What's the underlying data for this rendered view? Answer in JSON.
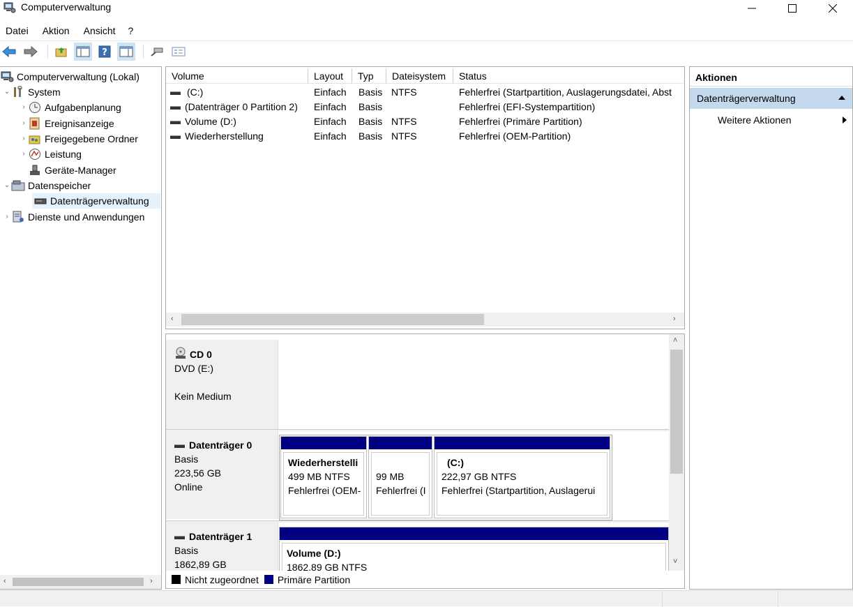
{
  "window": {
    "title": "Computerverwaltung"
  },
  "menu": [
    "Datei",
    "Aktion",
    "Ansicht",
    "?"
  ],
  "tree": {
    "root": "Computerverwaltung (Lokal)",
    "system": "System",
    "system_children": [
      "Aufgabenplanung",
      "Ereignisanzeige",
      "Freigegebene Ordner",
      "Leistung",
      "Geräte-Manager"
    ],
    "storage": "Datenspeicher",
    "storage_children": [
      "Datenträgerverwaltung"
    ],
    "services": "Dienste und Anwendungen"
  },
  "volume_list": {
    "columns": [
      "Volume",
      "Layout",
      "Typ",
      "Dateisystem",
      "Status"
    ],
    "rows": [
      {
        "volume": "(C:)",
        "layout": "Einfach",
        "typ": "Basis",
        "fs": "NTFS",
        "status": "Fehlerfrei (Startpartition, Auslagerungsdatei, Abst"
      },
      {
        "volume": "(Datenträger 0 Partition 2)",
        "layout": "Einfach",
        "typ": "Basis",
        "fs": "",
        "status": "Fehlerfrei (EFI-Systempartition)"
      },
      {
        "volume": "Volume (D:)",
        "layout": "Einfach",
        "typ": "Basis",
        "fs": "NTFS",
        "status": "Fehlerfrei (Primäre Partition)"
      },
      {
        "volume": "Wiederherstellung",
        "layout": "Einfach",
        "typ": "Basis",
        "fs": "NTFS",
        "status": "Fehlerfrei (OEM-Partition)"
      }
    ]
  },
  "disks": {
    "cd0": {
      "name": "CD 0",
      "line1": "DVD (E:)",
      "line2": "Kein Medium"
    },
    "disk0": {
      "name": "Datenträger 0",
      "line1": "Basis",
      "line2": "223,56 GB",
      "line3": "Online",
      "partitions": [
        {
          "name": "Wiederherstelli",
          "size": "499 MB NTFS",
          "status": "Fehlerfrei (OEM-"
        },
        {
          "name": "",
          "size": "99 MB",
          "status": "Fehlerfrei (I"
        },
        {
          "name": "(C:)",
          "size": "222,97 GB NTFS",
          "status": "Fehlerfrei (Startpartition, Auslagerui"
        }
      ]
    },
    "disk1": {
      "name": "Datenträger 1",
      "line1": "Basis",
      "line2": "1862,89 GB",
      "partitions": [
        {
          "name": "Volume  (D:)",
          "size": "1862,89 GB NTFS"
        }
      ]
    }
  },
  "legend": [
    {
      "label": "Nicht zugeordnet",
      "color": "#000000"
    },
    {
      "label": "Primäre Partition",
      "color": "#000080"
    }
  ],
  "actions": {
    "header": "Aktionen",
    "section": "Datenträgerverwaltung",
    "items": [
      "Weitere Aktionen"
    ]
  },
  "icons": {
    "toolbar": [
      "back-arrow-icon",
      "forward-arrow-icon",
      "up-folder-icon",
      "show-hide-tree-icon",
      "help-icon",
      "show-hide-action-icon",
      "connect-icon",
      "properties-icon"
    ]
  }
}
